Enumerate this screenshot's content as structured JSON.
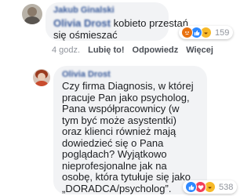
{
  "comment1": {
    "author": "Jakub Ginalski",
    "mention": "Olivia Drost",
    "text_line1": "kobieto przestań",
    "text_line2": "się ośmieszać",
    "reaction_count": "159"
  },
  "actions": {
    "time": "4 godz.",
    "like": "Lubię to!",
    "reply": "Odpowiedz",
    "more": "Więcej"
  },
  "comment2": {
    "author": "Olivia Drost",
    "lines": [
      "Czy firma Diagnosis, w której",
      "pracuje Pan jako psycholog,",
      "Pana współpracownicy (w",
      "tym być może asystentki)",
      "oraz klienci również mają",
      "dowiedzieć się o Pana",
      "poglądach? Wyjątkowo",
      "nieprofesjonalne jak na",
      "osobę, która tytułuje się jako",
      "„DORADCA/psycholog”."
    ],
    "reaction_count": "538"
  },
  "colors": {
    "like_blue": "#2d88ff",
    "love_red": "#f33e58",
    "haha_yellow": "#f7b928",
    "angry_orange": "#e9710f",
    "link_blue": "#365899"
  }
}
